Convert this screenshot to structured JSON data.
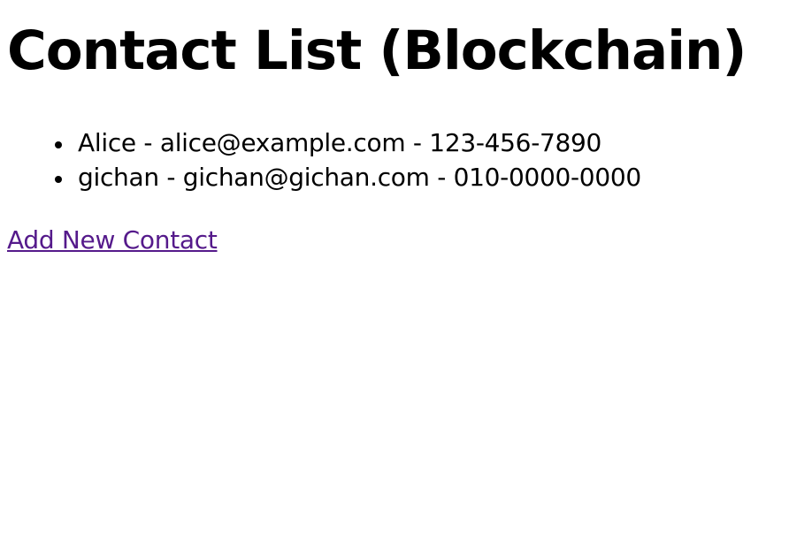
{
  "page": {
    "title": "Contact List (Blockchain)"
  },
  "contacts": [
    {
      "text": "Alice - alice@example.com - 123-456-7890"
    },
    {
      "text": "gichan - gichan@gichan.com - 010-0000-0000"
    }
  ],
  "actions": {
    "add_contact_label": "Add New Contact"
  },
  "colors": {
    "text": "#000000",
    "visited_link": "#551a8b",
    "background": "#ffffff"
  }
}
